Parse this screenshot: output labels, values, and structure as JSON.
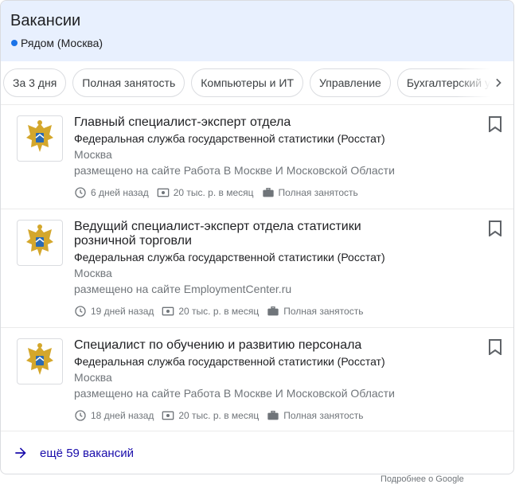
{
  "header": {
    "title": "Вакансии",
    "location": "Рядом (Москва)"
  },
  "chips": [
    {
      "label": "За 3 дня"
    },
    {
      "label": "Полная занятость"
    },
    {
      "label": "Компьютеры и ИТ"
    },
    {
      "label": "Управление"
    },
    {
      "label": "Бухгалтерский учёт"
    }
  ],
  "jobs": [
    {
      "title": "Главный специалист-эксперт отдела",
      "company": "Федеральная служба государственной статистики (Росстат)",
      "city": "Москва",
      "source": "размещено на сайте Работа В Москве И Московской Области",
      "posted": "6 дней назад",
      "salary": "20 тыс. р. в месяц",
      "employment": "Полная занятость"
    },
    {
      "title": "Ведущий специалист-эксперт отдела статистики розничной торговли",
      "company": "Федеральная служба государственной статистики (Росстат)",
      "city": "Москва",
      "source": "размещено на сайте EmploymentCenter.ru",
      "posted": "19 дней назад",
      "salary": "20 тыс. р. в месяц",
      "employment": "Полная занятость"
    },
    {
      "title": "Специалист по обучению и развитию персонала",
      "company": "Федеральная служба государственной статистики (Росстат)",
      "city": "Москва",
      "source": "размещено на сайте Работа В Москве И Московской Области",
      "posted": "18 дней назад",
      "salary": "20 тыс. р. в месяц",
      "employment": "Полная занятость"
    }
  ],
  "more_link": "ещё 59 вакансий",
  "footer_hint": "Подробнее о Google",
  "colors": {
    "header_bg": "#e8f0fe",
    "accent": "#1a73e8",
    "link": "#1a0dab"
  }
}
